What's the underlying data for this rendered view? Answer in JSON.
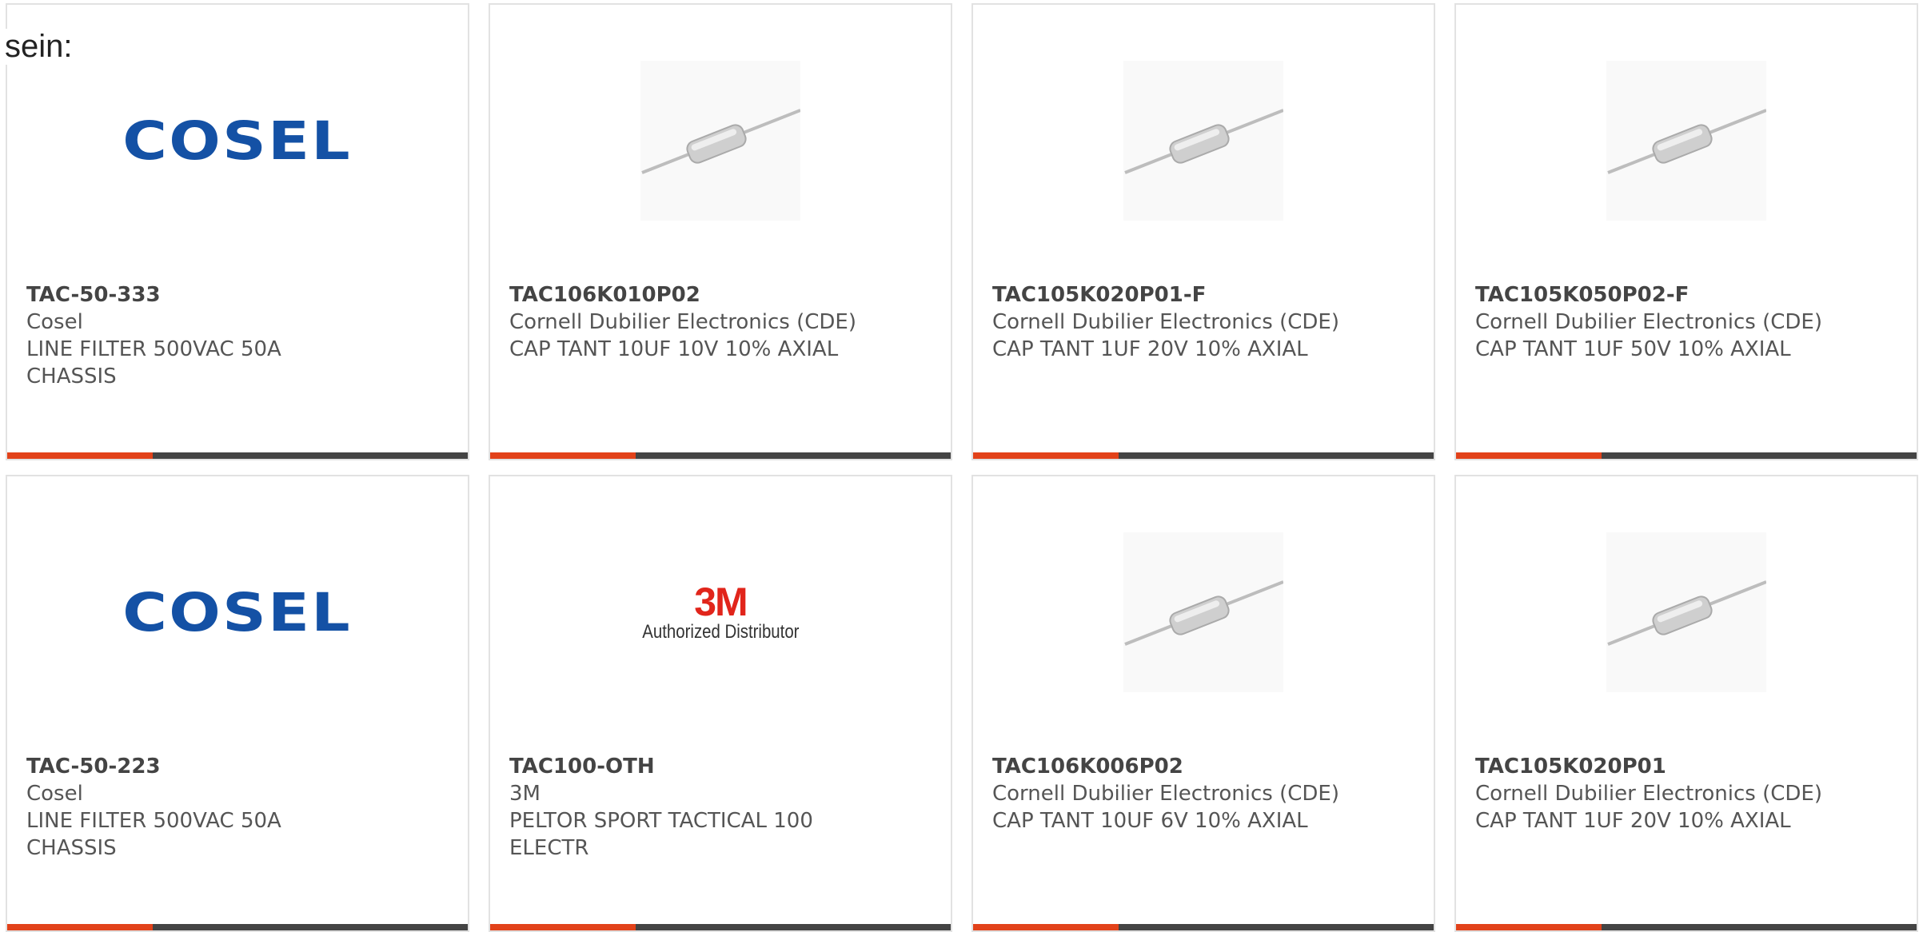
{
  "intro_text": "sein:",
  "colors": {
    "accent": "#e2421a",
    "bar": "#444444",
    "cosel_blue": "#1451a5",
    "m3_red": "#e1251b"
  },
  "products": [
    {
      "part_number": "TAC-50-333",
      "manufacturer": "Cosel",
      "description": "LINE FILTER 500VAC 50A CHASSIS",
      "image": "cosel-logo",
      "logo_text": "COSEL"
    },
    {
      "part_number": "TAC106K010P02",
      "manufacturer": "Cornell Dubilier Electronics (CDE)",
      "description": "CAP TANT 10UF 10V 10% AXIAL",
      "image": "axial-capacitor-icon"
    },
    {
      "part_number": "TAC105K020P01-F",
      "manufacturer": "Cornell Dubilier Electronics (CDE)",
      "description": "CAP TANT 1UF 20V 10% AXIAL",
      "image": "axial-capacitor-icon"
    },
    {
      "part_number": "TAC105K050P02-F",
      "manufacturer": "Cornell Dubilier Electronics (CDE)",
      "description": "CAP TANT 1UF 50V 10% AXIAL",
      "image": "axial-capacitor-icon"
    },
    {
      "part_number": "TAC-50-223",
      "manufacturer": "Cosel",
      "description": "LINE FILTER 500VAC 50A CHASSIS",
      "image": "cosel-logo",
      "logo_text": "COSEL"
    },
    {
      "part_number": "TAC100-OTH",
      "manufacturer": "3M",
      "description": "PELTOR SPORT TACTICAL 100 ELECTR",
      "image": "3m-logo",
      "logo_text": "3M",
      "logo_subtext": "Authorized Distributor"
    },
    {
      "part_number": "TAC106K006P02",
      "manufacturer": "Cornell Dubilier Electronics (CDE)",
      "description": "CAP TANT 10UF 6V 10% AXIAL",
      "image": "axial-capacitor-icon"
    },
    {
      "part_number": "TAC105K020P01",
      "manufacturer": "Cornell Dubilier Electronics (CDE)",
      "description": "CAP TANT 1UF 20V 10% AXIAL",
      "image": "axial-capacitor-icon"
    }
  ]
}
